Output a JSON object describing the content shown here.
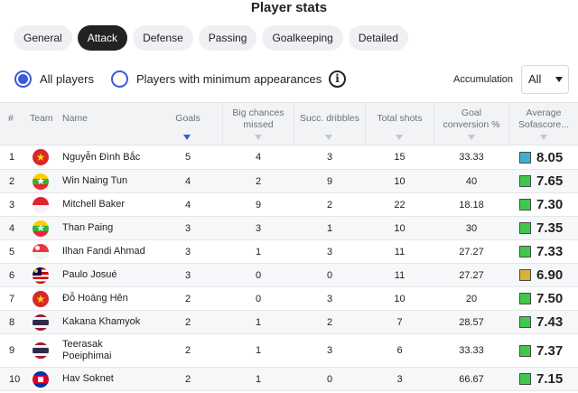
{
  "page": {
    "title": "Player stats"
  },
  "tabs": [
    {
      "label": "General",
      "active": false
    },
    {
      "label": "Attack",
      "active": true
    },
    {
      "label": "Defense",
      "active": false
    },
    {
      "label": "Passing",
      "active": false
    },
    {
      "label": "Goalkeeping",
      "active": false
    },
    {
      "label": "Detailed",
      "active": false
    }
  ],
  "filters": {
    "all_players": "All players",
    "min_appearances": "Players with minimum appearances",
    "selected": "all_players",
    "info_icon": "info-icon",
    "accumulation_label": "Accumulation",
    "accumulation_value": "All"
  },
  "table": {
    "headers": {
      "index": "#",
      "team": "Team",
      "name": "Name",
      "goals": "Goals",
      "big_chances_1": "Big chances",
      "big_chances_2": "missed",
      "dribbles": "Succ. dribbles",
      "shots": "Total shots",
      "conv_1": "Goal",
      "conv_2": "conversion %",
      "rating_1": "Average",
      "rating_2": "Sofascore..."
    },
    "sorted_column": "goals",
    "rating_colors": {
      "green": "#3ec94a",
      "blue": "#3fb0d0",
      "gold": "#d2b33c"
    },
    "rows": [
      {
        "index": "1",
        "team": "vietnam",
        "name": "Nguyễn Đình Bắc",
        "goals": "5",
        "big_chances_missed": "4",
        "dribbles": "3",
        "shots": "15",
        "conversion": "33.33",
        "rating": "8.05",
        "rating_color": "blue"
      },
      {
        "index": "2",
        "team": "myanmar",
        "name": "Win Naing Tun",
        "goals": "4",
        "big_chances_missed": "2",
        "dribbles": "9",
        "shots": "10",
        "conversion": "40",
        "rating": "7.65",
        "rating_color": "green"
      },
      {
        "index": "3",
        "team": "indonesia",
        "name": "Mitchell Baker",
        "goals": "4",
        "big_chances_missed": "9",
        "dribbles": "2",
        "shots": "22",
        "conversion": "18.18",
        "rating": "7.30",
        "rating_color": "green"
      },
      {
        "index": "4",
        "team": "myanmar",
        "name": "Than Paing",
        "goals": "3",
        "big_chances_missed": "3",
        "dribbles": "1",
        "shots": "10",
        "conversion": "30",
        "rating": "7.35",
        "rating_color": "green"
      },
      {
        "index": "5",
        "team": "singapore",
        "name": "Ilhan Fandi Ahmad",
        "goals": "3",
        "big_chances_missed": "1",
        "dribbles": "3",
        "shots": "11",
        "conversion": "27.27",
        "rating": "7.33",
        "rating_color": "green"
      },
      {
        "index": "6",
        "team": "malaysia",
        "name": "Paulo Josué",
        "goals": "3",
        "big_chances_missed": "0",
        "dribbles": "0",
        "shots": "11",
        "conversion": "27.27",
        "rating": "6.90",
        "rating_color": "gold"
      },
      {
        "index": "7",
        "team": "vietnam",
        "name": "Đỗ Hoàng Hên",
        "goals": "2",
        "big_chances_missed": "0",
        "dribbles": "3",
        "shots": "10",
        "conversion": "20",
        "rating": "7.50",
        "rating_color": "green"
      },
      {
        "index": "8",
        "team": "thailand",
        "name": "Kakana Khamyok",
        "goals": "2",
        "big_chances_missed": "1",
        "dribbles": "2",
        "shots": "7",
        "conversion": "28.57",
        "rating": "7.43",
        "rating_color": "green"
      },
      {
        "index": "9",
        "team": "thailand",
        "name": "Teerasak Poeiphimai",
        "goals": "2",
        "big_chances_missed": "1",
        "dribbles": "3",
        "shots": "6",
        "conversion": "33.33",
        "rating": "7.37",
        "rating_color": "green"
      },
      {
        "index": "10",
        "team": "cambodia",
        "name": "Hav Soknet",
        "goals": "2",
        "big_chances_missed": "1",
        "dribbles": "0",
        "shots": "3",
        "conversion": "66.67",
        "rating": "7.15",
        "rating_color": "green"
      }
    ]
  }
}
